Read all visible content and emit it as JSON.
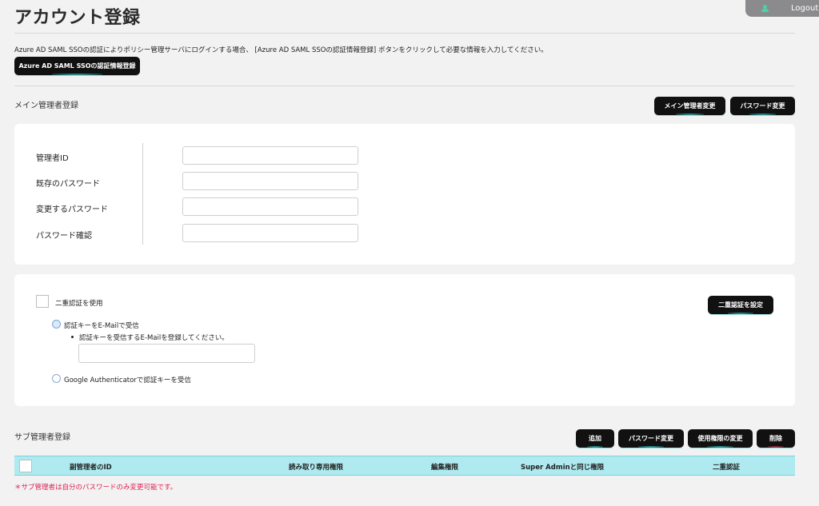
{
  "page": {
    "title": "アカウント登録"
  },
  "header": {
    "logout_label": "Logout"
  },
  "sso": {
    "description": "Azure AD SAML SSOの認証によりポリシー管理サーバにログインする場合、 [Azure AD SAML SSOの認証情報登録] ボタンをクリックして必要な情報を入力してください。",
    "button_label": "Azure AD SAML SSOの認証情報登録"
  },
  "main_admin": {
    "section_title": "メイン管理者登録",
    "change_main_admin_label": "メイン管理者変更",
    "change_password_label": "パスワード変更",
    "fields": {
      "admin_id": {
        "label": "管理者ID",
        "value": ""
      },
      "current_password": {
        "label": "既存のパスワード",
        "value": ""
      },
      "new_password": {
        "label": "変更するパスワード",
        "value": ""
      },
      "confirm_password": {
        "label": "パスワード確認",
        "value": ""
      }
    }
  },
  "two_factor": {
    "enable_label": "二重認証を使用",
    "set_button_label": "二重認証を設定",
    "email_option_label": "認証キーをE-Mailで受信",
    "email_hint": "認証キーを受信するE-Mailを登録してください。",
    "email_value": "",
    "google_option_label": "Google Authenticatorで認証キーを受信"
  },
  "sub_admin": {
    "section_title": "サブ管理者登録",
    "buttons": {
      "add": "追加",
      "change_password": "パスワード変更",
      "change_permission": "使用権限の変更",
      "delete": "削除"
    },
    "columns": [
      "副管理者のID",
      "読み取り専用権限",
      "編集権限",
      "Super Adminと同じ権限",
      "二重認証"
    ],
    "note": "＊サブ管理者は自分のパスワードのみ変更可能です。"
  }
}
